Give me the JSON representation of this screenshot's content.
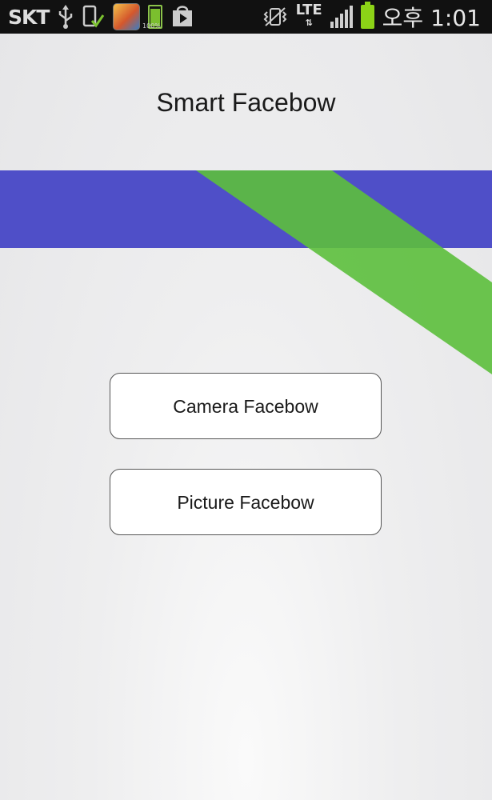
{
  "status_bar": {
    "carrier": "SKT",
    "battery_small_label": "100%",
    "network": "LTE",
    "time_prefix": "오후",
    "time": "1:01",
    "icons": [
      "usb-icon",
      "device-check-icon",
      "app-thumbnail-icon",
      "battery-icon",
      "play-store-icon",
      "vibrate-icon",
      "lte-icon",
      "signal-icon",
      "battery-full-icon"
    ]
  },
  "app": {
    "title": "Smart Facebow"
  },
  "banner": {
    "blue": "#4f4fc8",
    "green": "#5cbf3c"
  },
  "buttons": {
    "camera_label": "Camera Facebow",
    "picture_label": "Picture Facebow"
  }
}
